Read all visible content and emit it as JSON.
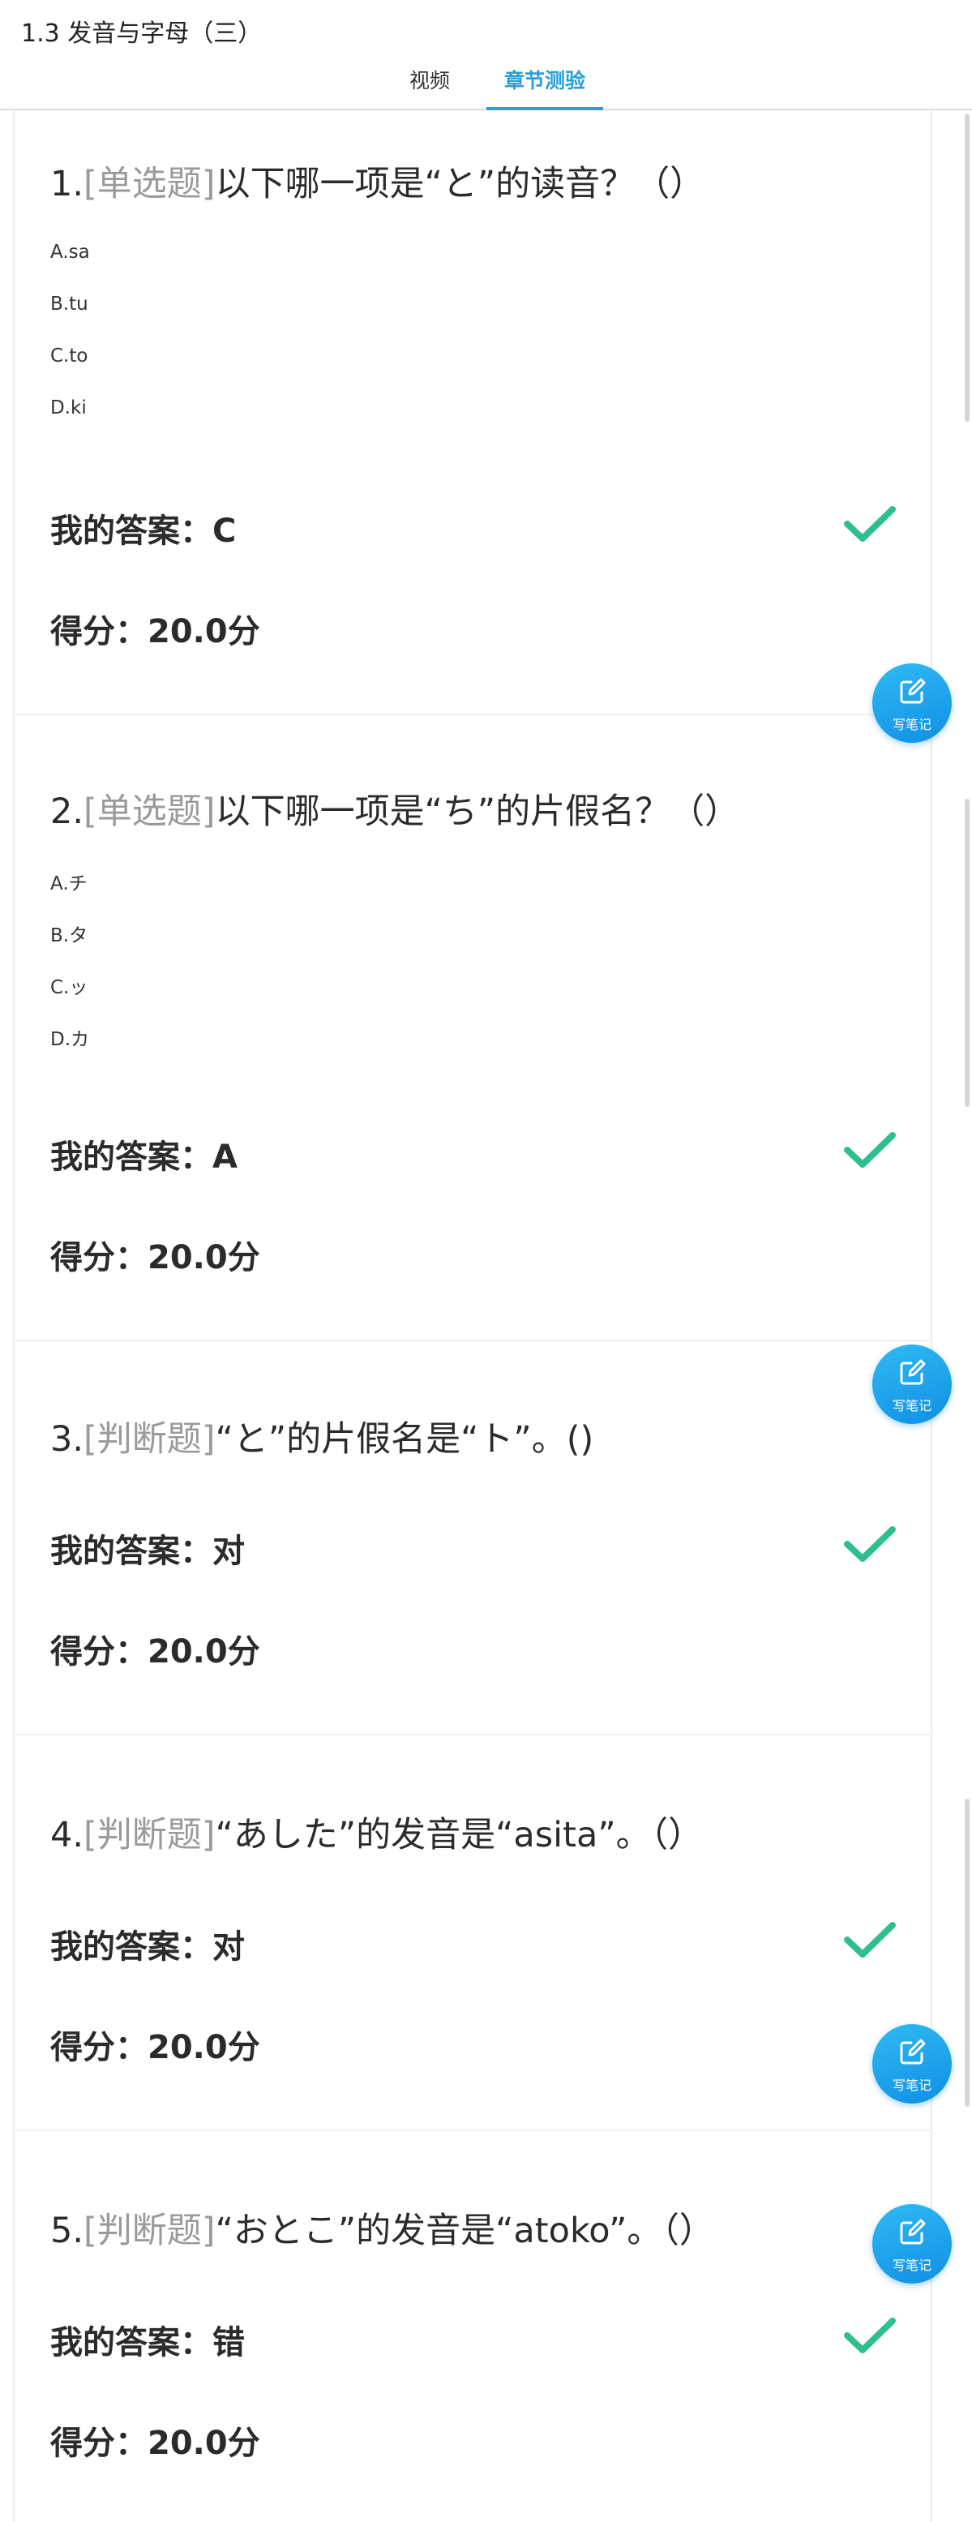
{
  "header": {
    "title": "1.3 发音与字母（三）",
    "tabs": [
      {
        "label": "视频",
        "active": false
      },
      {
        "label": "章节测验",
        "active": true
      }
    ]
  },
  "colors": {
    "accent": "#2a9fd6",
    "check": "#2dbf8f",
    "note_button": "#1ea7ee",
    "question_type": "#9a9a9a"
  },
  "questions": [
    {
      "number": "1.",
      "type": "[单选题]",
      "text": "以下哪一项是“と”的读音？（）",
      "options": [
        "A.sa",
        "B.tu",
        "C.to",
        "D.ki"
      ],
      "answer_label": "我的答案：",
      "answer": "C",
      "score_label": "得分：",
      "score": "20.0分",
      "correct": true
    },
    {
      "number": "2.",
      "type": "[单选题]",
      "text": "以下哪一项是“ち”的片假名？（）",
      "options": [
        "A.チ",
        "B.タ",
        "C.ッ",
        "D.カ"
      ],
      "answer_label": "我的答案：",
      "answer": "A",
      "score_label": "得分：",
      "score": "20.0分",
      "correct": true
    },
    {
      "number": "3.",
      "type": "[判断题]",
      "text": "“と”的片假名是“ト”。()",
      "options": [],
      "answer_label": "我的答案：",
      "answer": "对",
      "score_label": "得分：",
      "score": "20.0分",
      "correct": true
    },
    {
      "number": "4.",
      "type": "[判断题]",
      "text": "“あした”的发音是“asita”。（）",
      "options": [],
      "answer_label": "我的答案：",
      "answer": "对",
      "score_label": "得分：",
      "score": "20.0分",
      "correct": true
    },
    {
      "number": "5.",
      "type": "[判断题]",
      "text": "“おとこ”的发音是“atoko”。（）",
      "options": [],
      "answer_label": "我的答案：",
      "answer": "错",
      "score_label": "得分：",
      "score": "20.0分",
      "correct": true
    }
  ],
  "note_button": {
    "label": "写笔记",
    "icon": "edit-note-icon"
  }
}
